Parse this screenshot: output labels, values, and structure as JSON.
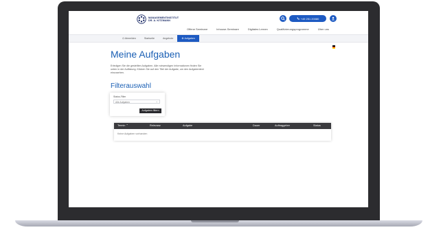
{
  "header": {
    "logo_line1": "MANAGEMENTINSTITUT",
    "logo_line2": "DR. A. KITZMANN",
    "phone": "+49 251 20080",
    "nav": [
      "Offene Seminare",
      "Inhouse-Seminare",
      "Digitales Lernen",
      "Qualifizierungsprogramme",
      "Über uns"
    ]
  },
  "subnav": [
    "Abmelden",
    "Startseite",
    "Angebote",
    "Aufgaben"
  ],
  "page": {
    "title": "Meine Aufgaben",
    "intro": "Erledigen Sie die gestellten Aufgaben. Alle notwendigen Informationen finden Sie unten in der Auflistung. Klicken Sie auf den Titel der Aufgabe, um den Aufgabentext einzusehen.",
    "filter_heading": "Filterauswahl"
  },
  "filter": {
    "label": "Status-Filter",
    "selected": "Alle Aufgaben",
    "button": "Aufgaben filtern"
  },
  "table": {
    "columns": [
      "Termin",
      "Relevanz",
      "Aufgabe",
      "Dauer",
      "Auftraggeber",
      "Status"
    ],
    "empty_text": "Keine Aufgaben vorhanden"
  },
  "colors": {
    "accent": "#1d5ac2",
    "heading": "#1a5fb4",
    "table_header": "#3a3a3e",
    "laptop_frame": "#2c2c2f"
  }
}
